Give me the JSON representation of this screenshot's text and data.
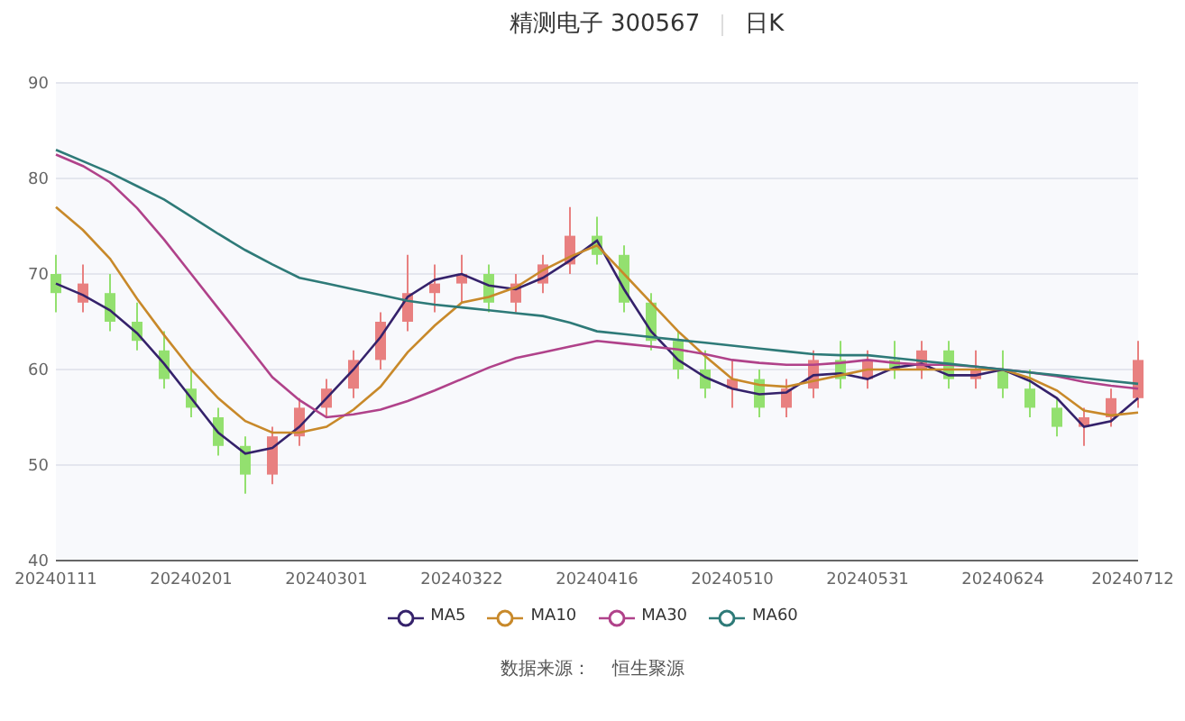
{
  "title": {
    "name": "精测电子 300567",
    "period": "日K"
  },
  "chart": {
    "chart_data": {
      "type": "candlestick",
      "grid": true,
      "ylim": [
        40,
        90
      ],
      "yticks": [
        40,
        50,
        60,
        70,
        80,
        90
      ],
      "categories": [
        "20240111",
        null,
        null,
        null,
        null,
        "20240201",
        null,
        null,
        null,
        null,
        "20240301",
        null,
        null,
        null,
        null,
        "20240322",
        null,
        null,
        null,
        null,
        "20240416",
        null,
        null,
        null,
        null,
        "20240510",
        null,
        null,
        null,
        null,
        "20240531",
        null,
        null,
        null,
        null,
        "20240624",
        null,
        null,
        null,
        null,
        "20240712"
      ],
      "ohlc": [
        [
          70,
          72,
          66,
          68
        ],
        [
          67,
          71,
          66,
          69
        ],
        [
          68,
          70,
          64,
          65
        ],
        [
          65,
          67,
          62,
          63
        ],
        [
          62,
          64,
          58,
          59
        ],
        [
          58,
          60,
          55,
          56
        ],
        [
          55,
          56,
          51,
          52
        ],
        [
          52,
          53,
          47,
          49
        ],
        [
          49,
          54,
          48,
          53
        ],
        [
          53,
          57,
          52,
          56
        ],
        [
          56,
          59,
          55,
          58
        ],
        [
          58,
          62,
          57,
          61
        ],
        [
          61,
          66,
          60,
          65
        ],
        [
          65,
          72,
          64,
          68
        ],
        [
          68,
          71,
          66,
          69
        ],
        [
          69,
          72,
          67,
          70
        ],
        [
          70,
          71,
          66,
          67
        ],
        [
          67,
          70,
          66,
          69
        ],
        [
          69,
          72,
          68,
          71
        ],
        [
          71,
          77,
          70,
          74
        ],
        [
          74,
          76,
          71,
          72
        ],
        [
          72,
          73,
          66,
          67
        ],
        [
          67,
          68,
          62,
          63
        ],
        [
          63,
          64,
          59,
          60
        ],
        [
          60,
          62,
          57,
          58
        ],
        [
          58,
          61,
          56,
          59
        ],
        [
          59,
          60,
          55,
          56
        ],
        [
          56,
          59,
          55,
          58
        ],
        [
          58,
          62,
          57,
          61
        ],
        [
          61,
          63,
          58,
          59
        ],
        [
          59,
          62,
          58,
          61
        ],
        [
          61,
          63,
          59,
          60
        ],
        [
          60,
          63,
          59,
          62
        ],
        [
          62,
          63,
          58,
          59
        ],
        [
          59,
          62,
          58,
          60
        ],
        [
          60,
          62,
          57,
          58
        ],
        [
          58,
          60,
          55,
          56
        ],
        [
          56,
          57,
          53,
          54
        ],
        [
          54,
          56,
          52,
          55
        ],
        [
          55,
          58,
          54,
          57
        ],
        [
          57,
          63,
          56,
          61
        ]
      ],
      "series": [
        {
          "name": "MA5",
          "type": "line",
          "color": "#35226b",
          "values": [
            69,
            67.8,
            66.2,
            63.8,
            60.6,
            57,
            53.4,
            51.2,
            51.8,
            54,
            57,
            60,
            63.4,
            67.6,
            69.4,
            70,
            68.8,
            68.4,
            69.6,
            71.4,
            73.5,
            68.4,
            64,
            61,
            59.2,
            58,
            57.4,
            57.6,
            59.4,
            59.6,
            59,
            60.2,
            60.6,
            59.4,
            59.4,
            60,
            58.8,
            57,
            54,
            54.6,
            57
          ]
        },
        {
          "name": "MA10",
          "type": "line",
          "color": "#c8892a",
          "values": [
            77,
            74.6,
            71.6,
            67.4,
            63.6,
            60,
            57,
            54.6,
            53.4,
            53.4,
            54,
            55.8,
            58.2,
            61.8,
            64.6,
            67,
            67.6,
            68.6,
            70.4,
            71.8,
            73,
            70,
            67,
            64,
            61.4,
            59,
            58.4,
            58.2,
            58.8,
            59.4,
            60,
            60,
            60,
            60,
            60,
            60,
            59.1,
            57.8,
            55.7,
            55.2,
            55.5
          ]
        },
        {
          "name": "MA30",
          "type": "line",
          "color": "#b0428a",
          "values": [
            82.5,
            81.3,
            79.6,
            76.9,
            73.6,
            70,
            66.4,
            62.8,
            59.2,
            56.8,
            55,
            55.3,
            55.8,
            56.7,
            57.8,
            59,
            60.2,
            61.2,
            61.8,
            62.4,
            63,
            62.7,
            62.4,
            62.1,
            61.6,
            61,
            60.7,
            60.5,
            60.5,
            60.7,
            61,
            60.7,
            60.5,
            60.5,
            60.3,
            60,
            59.7,
            59.3,
            58.7,
            58.3,
            58
          ]
        },
        {
          "name": "MA60",
          "type": "line",
          "color": "#2e7a78",
          "values": [
            83,
            81.8,
            80.6,
            79.2,
            77.8,
            76,
            74.2,
            72.5,
            71,
            69.6,
            69,
            68.4,
            67.8,
            67.2,
            66.8,
            66.5,
            66.2,
            65.9,
            65.6,
            64.9,
            64,
            63.7,
            63.4,
            63.1,
            62.8,
            62.5,
            62.2,
            61.9,
            61.6,
            61.5,
            61.5,
            61.2,
            60.9,
            60.6,
            60.3,
            60,
            59.7,
            59.4,
            59.1,
            58.8,
            58.5
          ]
        }
      ]
    }
  },
  "source": {
    "label": "数据来源：",
    "value": "恒生聚源"
  }
}
